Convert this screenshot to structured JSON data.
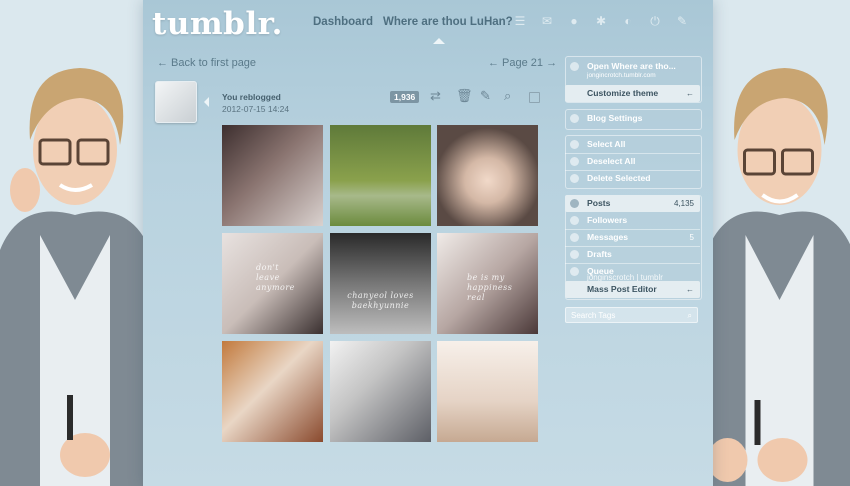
{
  "header": {
    "logo": "tumblr.",
    "nav": [
      "Dashboard",
      "Where are thou LuHan?"
    ],
    "icons": [
      "list-icon",
      "mail-icon",
      "globe-icon",
      "gear-icon",
      "compass-icon",
      "power-icon",
      "wand-icon"
    ]
  },
  "pagination": {
    "back": "← Back to first page",
    "page": "← Page 21 →"
  },
  "post": {
    "label": "You reblogged",
    "date": "2012-07-15 14:24",
    "notes": "1,936",
    "tools": [
      "reblog-icon",
      "trash-icon",
      "edit-icon",
      "search-icon",
      "select-icon"
    ]
  },
  "photos": [
    {
      "caption": ""
    },
    {
      "caption": ""
    },
    {
      "caption": ""
    },
    {
      "caption": "don't leave anymore"
    },
    {
      "caption": "chanyeol loves baekhyunnie"
    },
    {
      "caption": "be is my happiness real"
    },
    {
      "caption": ""
    },
    {
      "caption": ""
    },
    {
      "caption": ""
    }
  ],
  "sidebar": {
    "open_title": "Open Where are tho...",
    "open_url": "jongincrotch.tumblr.com",
    "customize": "Customize theme",
    "blog_settings": "Blog Settings",
    "select_all": "Select All",
    "deselect_all": "Deselect All",
    "delete_selected": "Delete Selected",
    "posts": "Posts",
    "posts_count": "4,135",
    "followers": "Followers",
    "messages": "Messages",
    "messages_count": "5",
    "drafts": "Drafts",
    "queue": "Queue",
    "queue_overlay": "jonginscrotch | tumblr",
    "mass_editor": "Mass Post Editor",
    "search_placeholder": "Search Tags"
  },
  "colors": {
    "panel": "#b8d2df",
    "accent_text": "#4e6f80",
    "badge": "#7c95a3"
  }
}
